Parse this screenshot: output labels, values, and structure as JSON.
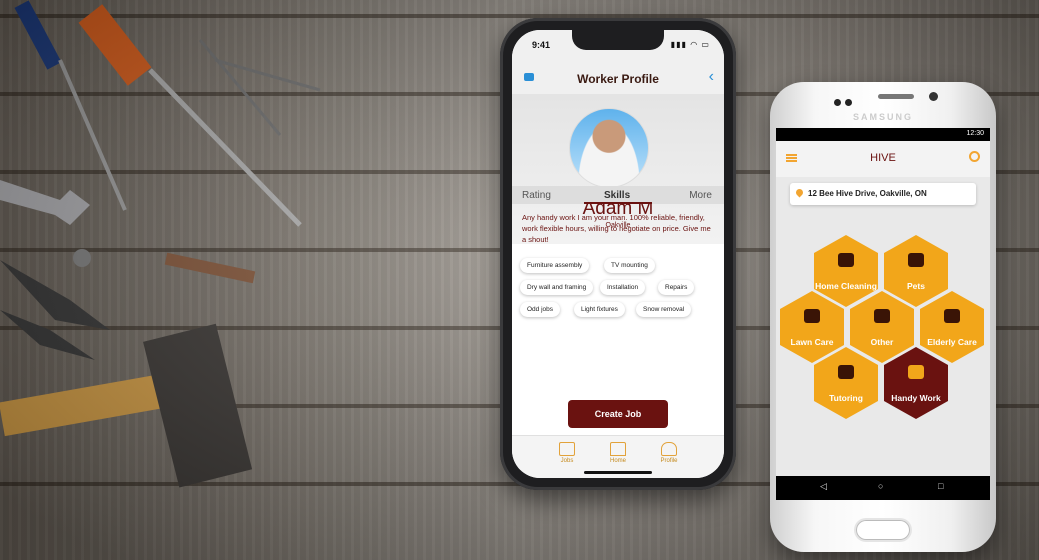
{
  "iphone": {
    "status_time": "9:41",
    "header_title": "Worker Profile",
    "profile": {
      "name": "Adam M",
      "city": "Oakville"
    },
    "tabs": [
      {
        "label": "Rating"
      },
      {
        "label": "Skills"
      },
      {
        "label": "More"
      }
    ],
    "active_tab": "Skills",
    "bio": "Any handy work I am your man. 100% reliable, friendly, work flexible hours, willing to negotiate on price. Give me a shout!",
    "skills": [
      "Furniture assembly",
      "TV mounting",
      "Dry wall and framing",
      "Installation",
      "Repairs",
      "Odd jobs",
      "Light fixtures",
      "Snow removal"
    ],
    "create_button": "Create Job",
    "tabbar": [
      {
        "label": "Jobs",
        "icon": "briefcase-icon"
      },
      {
        "label": "Home",
        "icon": "home-icon"
      },
      {
        "label": "Profile",
        "icon": "user-icon"
      }
    ],
    "colors": {
      "accent": "#6a1210",
      "link": "#2a8fd6",
      "tab_icon": "#e2a23a"
    }
  },
  "samsung": {
    "brand": "SAMSUNG",
    "status_time": "12:30",
    "app_title": "HIVE",
    "address": "12 Bee Hive Drive, Oakville, ON",
    "services": [
      {
        "label": "Home Cleaning",
        "icon": "spray-bottle-icon"
      },
      {
        "label": "Pets",
        "icon": "paw-icon"
      },
      {
        "label": "Lawn Care",
        "icon": "lawn-mower-icon"
      },
      {
        "label": "Other",
        "icon": "lightbulb-icon"
      },
      {
        "label": "Elderly Care",
        "icon": "elderly-person-icon"
      },
      {
        "label": "Tutoring",
        "icon": "teacher-icon"
      },
      {
        "label": "Handy Work",
        "icon": "tools-icon",
        "selected": true
      }
    ],
    "nav": {
      "back": "◁",
      "home": "○",
      "recent": "□"
    },
    "colors": {
      "hex": "#f2a61a",
      "hex_selected": "#6a1210"
    }
  }
}
